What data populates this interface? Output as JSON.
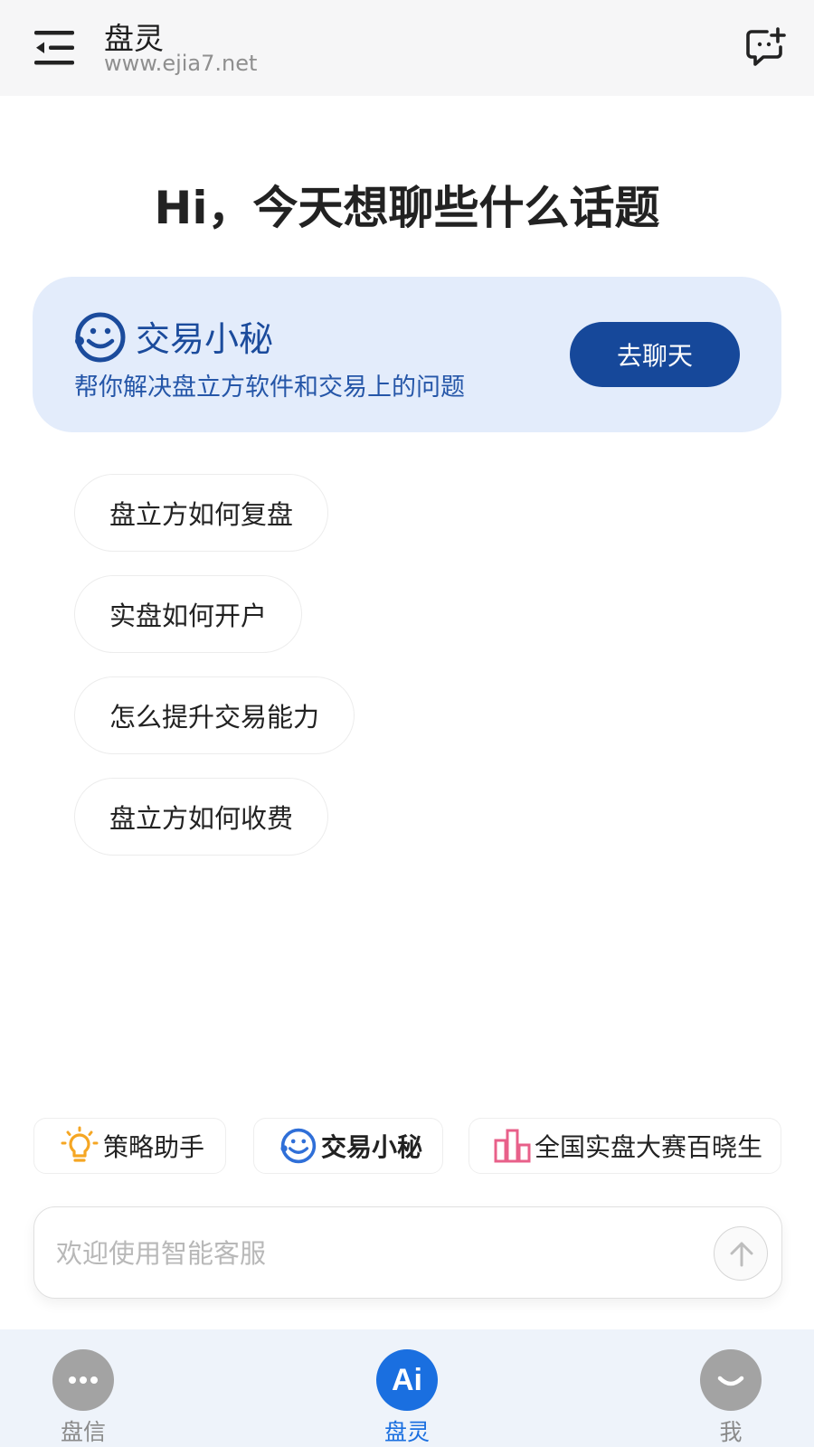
{
  "header": {
    "title": "盘灵",
    "subtitle": "www.ejia7.net"
  },
  "greeting": "Hi，今天想聊些什么话题",
  "promo": {
    "title": "交易小秘",
    "description": "帮你解决盘立方软件和交易上的问题",
    "button_label": "去聊天"
  },
  "suggestions": [
    {
      "label": "盘立方如何复盘"
    },
    {
      "label": "实盘如何开户"
    },
    {
      "label": "怎么提升交易能力"
    },
    {
      "label": "盘立方如何收费"
    }
  ],
  "tools": [
    {
      "label": "策略助手",
      "icon": "lightbulb-icon"
    },
    {
      "label": "交易小秘",
      "icon": "smiley-bot-icon"
    },
    {
      "label": "全国实盘大赛百晓生",
      "icon": "bar-chart-icon"
    }
  ],
  "input": {
    "placeholder": "欢迎使用智能客服"
  },
  "bottom_nav": {
    "items": [
      {
        "label": "盘信",
        "icon": "chat-dots-icon",
        "active": false
      },
      {
        "label": "盘灵",
        "icon": "ai-icon",
        "active": true
      },
      {
        "label": "我",
        "icon": "profile-smile-icon",
        "active": false
      }
    ],
    "ai_icon_text": "Ai"
  },
  "colors": {
    "accent": "#1a6fe0",
    "promo_bg": "#e3ecfb",
    "promo_button": "#16489a",
    "lightbulb": "#f5a623",
    "chart_pink": "#e8608a"
  }
}
